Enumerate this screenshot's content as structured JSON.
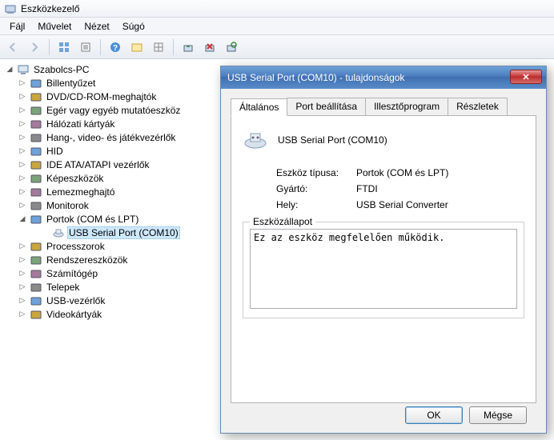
{
  "window": {
    "title": "Eszközkezelő"
  },
  "menu": {
    "items": [
      "Fájl",
      "Művelet",
      "Nézet",
      "Súgó"
    ]
  },
  "tree": {
    "root": "Szabolcs-PC",
    "nodes": [
      {
        "label": "Billentyűzet"
      },
      {
        "label": "DVD/CD-ROM-meghajtók"
      },
      {
        "label": "Egér vagy egyéb mutatóeszköz"
      },
      {
        "label": "Hálózati kártyák"
      },
      {
        "label": "Hang-, video- és játékvezérlők"
      },
      {
        "label": "HID"
      },
      {
        "label": "IDE ATA/ATAPI vezérlők"
      },
      {
        "label": "Képeszközök"
      },
      {
        "label": "Lemezmeghajtó"
      },
      {
        "label": "Monitorok"
      },
      {
        "label": "Portok (COM és LPT)",
        "expanded": true,
        "children": [
          {
            "label": "USB Serial Port (COM10)",
            "selected": true
          }
        ]
      },
      {
        "label": "Processzorok"
      },
      {
        "label": "Rendszereszközök"
      },
      {
        "label": "Számítógép"
      },
      {
        "label": "Telepek"
      },
      {
        "label": "USB-vezérlők"
      },
      {
        "label": "Videokártyák"
      }
    ]
  },
  "dialog": {
    "title": "USB Serial Port (COM10) - tulajdonságok",
    "tabs": [
      "Általános",
      "Port beállítása",
      "Illesztőprogram",
      "Részletek"
    ],
    "device_name": "USB Serial Port (COM10)",
    "props": {
      "type_label": "Eszköz típusa:",
      "type_value": "Portok (COM és LPT)",
      "mfr_label": "Gyártó:",
      "mfr_value": "FTDI",
      "loc_label": "Hely:",
      "loc_value": "USB Serial Converter"
    },
    "status_legend": "Eszközállapot",
    "status_text": "Ez az eszköz megfelelően működik.",
    "ok": "OK",
    "cancel": "Mégse"
  }
}
